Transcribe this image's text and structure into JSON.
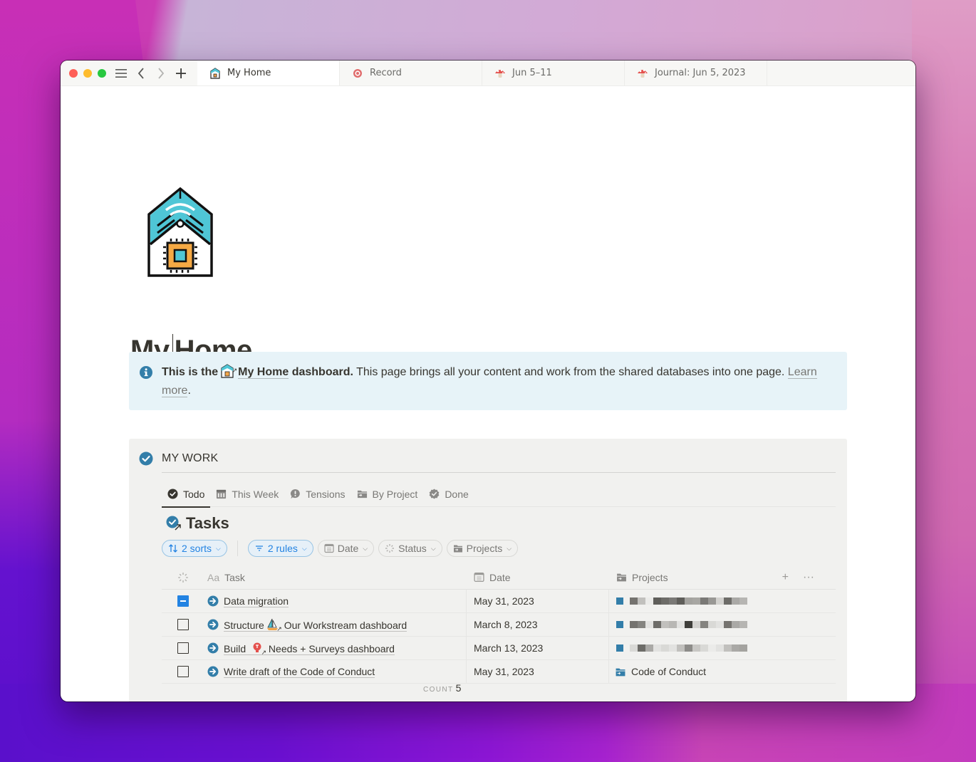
{
  "window": {
    "nav": {
      "sidebar_icon": "hamburger-icon",
      "back_icon": "chevron-left-icon",
      "forward_icon": "chevron-right-icon",
      "new_tab_icon": "plus-icon"
    },
    "tabs": [
      {
        "label": "My Home",
        "icon": "smart-home-icon",
        "active": true
      },
      {
        "label": "Record",
        "icon": "target-icon",
        "active": false
      },
      {
        "label": "Jun 5–11",
        "icon": "mushroom-icon",
        "active": false
      },
      {
        "label": "Journal: Jun 5, 2023",
        "icon": "mushroom-icon",
        "active": false
      }
    ]
  },
  "page": {
    "icon": "smart-home-icon",
    "title_part1": "My",
    "title_part2": "Home",
    "callout": {
      "icon": "info-icon",
      "bold_prefix": "This is the",
      "link_label": "My Home",
      "bold_suffix": "dashboard.",
      "body": " This page brings all your content and work from the shared databases into one page. ",
      "learn_more_1": "Learn",
      "learn_more_2": "more",
      "end": "."
    }
  },
  "my_work": {
    "title": "MY WORK",
    "icon": "check-circle-icon",
    "views": [
      {
        "label": "Todo",
        "icon": "check-circle-icon",
        "active": true
      },
      {
        "label": "This Week",
        "icon": "calendar-icon",
        "active": false
      },
      {
        "label": "Tensions",
        "icon": "exclamation-bubble-icon",
        "active": false
      },
      {
        "label": "By Project",
        "icon": "folder-icon",
        "active": false
      },
      {
        "label": "Done",
        "icon": "verified-badge-icon",
        "active": false
      }
    ],
    "database": {
      "title": "Tasks",
      "filters": {
        "sorts": "2 sorts",
        "rules": "2 rules",
        "date": "Date",
        "status": "Status",
        "projects": "Projects"
      },
      "columns": {
        "status": "",
        "task": "Task",
        "task_prefix": "Aa",
        "date": "Date",
        "projects": "Projects"
      },
      "rows": [
        {
          "state": "partial",
          "parts": [
            "Data migration"
          ],
          "date": "May 31, 2023",
          "project": "",
          "project_redacted": true
        },
        {
          "state": "unchecked",
          "parts": [
            "Structure",
            "Our Workstream dashboard"
          ],
          "date": "March 8, 2023",
          "project": "",
          "project_redacted": true
        },
        {
          "state": "unchecked",
          "parts": [
            "Build",
            "Needs + Surveys dashboard"
          ],
          "date": "March 13, 2023",
          "project": "",
          "project_redacted": true
        },
        {
          "state": "unchecked",
          "parts": [
            "Write draft of the Code of Conduct"
          ],
          "date": "May 31, 2023",
          "project": "Code of Conduct",
          "project_redacted": false
        }
      ],
      "count_label": "COUNT",
      "count_value": "5"
    }
  },
  "colors": {
    "accent_blue": "#2383e2",
    "icon_blue": "#337ea9",
    "callout_bg": "#e7f3f8",
    "section_bg": "#f1f1ef",
    "text": "#37352f"
  }
}
